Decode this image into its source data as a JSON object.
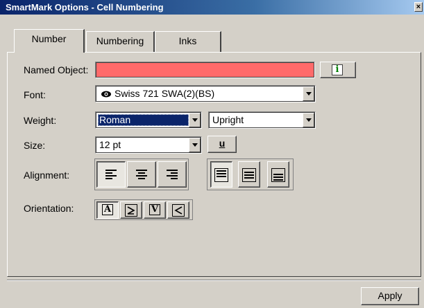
{
  "window": {
    "title": "SmartMark Options - Cell Numbering",
    "close_glyph": "×"
  },
  "tabs": [
    {
      "label": "Number",
      "active": true
    },
    {
      "label": "Numbering",
      "active": false
    },
    {
      "label": "Inks",
      "active": false
    }
  ],
  "form": {
    "named_object": {
      "label": "Named Object:",
      "value": "",
      "bg_color": "#ff6a6a"
    },
    "info_button": {
      "glyph": "i",
      "color": "#008000"
    },
    "font": {
      "label": "Font:",
      "value": "Swiss 721 SWA(2)(BS)",
      "icon": "eye-icon"
    },
    "weight": {
      "label": "Weight:",
      "value": "Roman",
      "style_value": "Upright"
    },
    "size": {
      "label": "Size:",
      "value": "12 pt",
      "underline_glyph": "u"
    },
    "alignment": {
      "label": "Alignment:"
    },
    "orientation": {
      "label": "Orientation:",
      "glyph_a": "A",
      "glyph_v": "V"
    }
  },
  "footer": {
    "apply_label": "Apply"
  },
  "colors": {
    "selection": "#0a246a",
    "error_field": "#ff6a6a",
    "chrome": "#d4d0c8"
  }
}
